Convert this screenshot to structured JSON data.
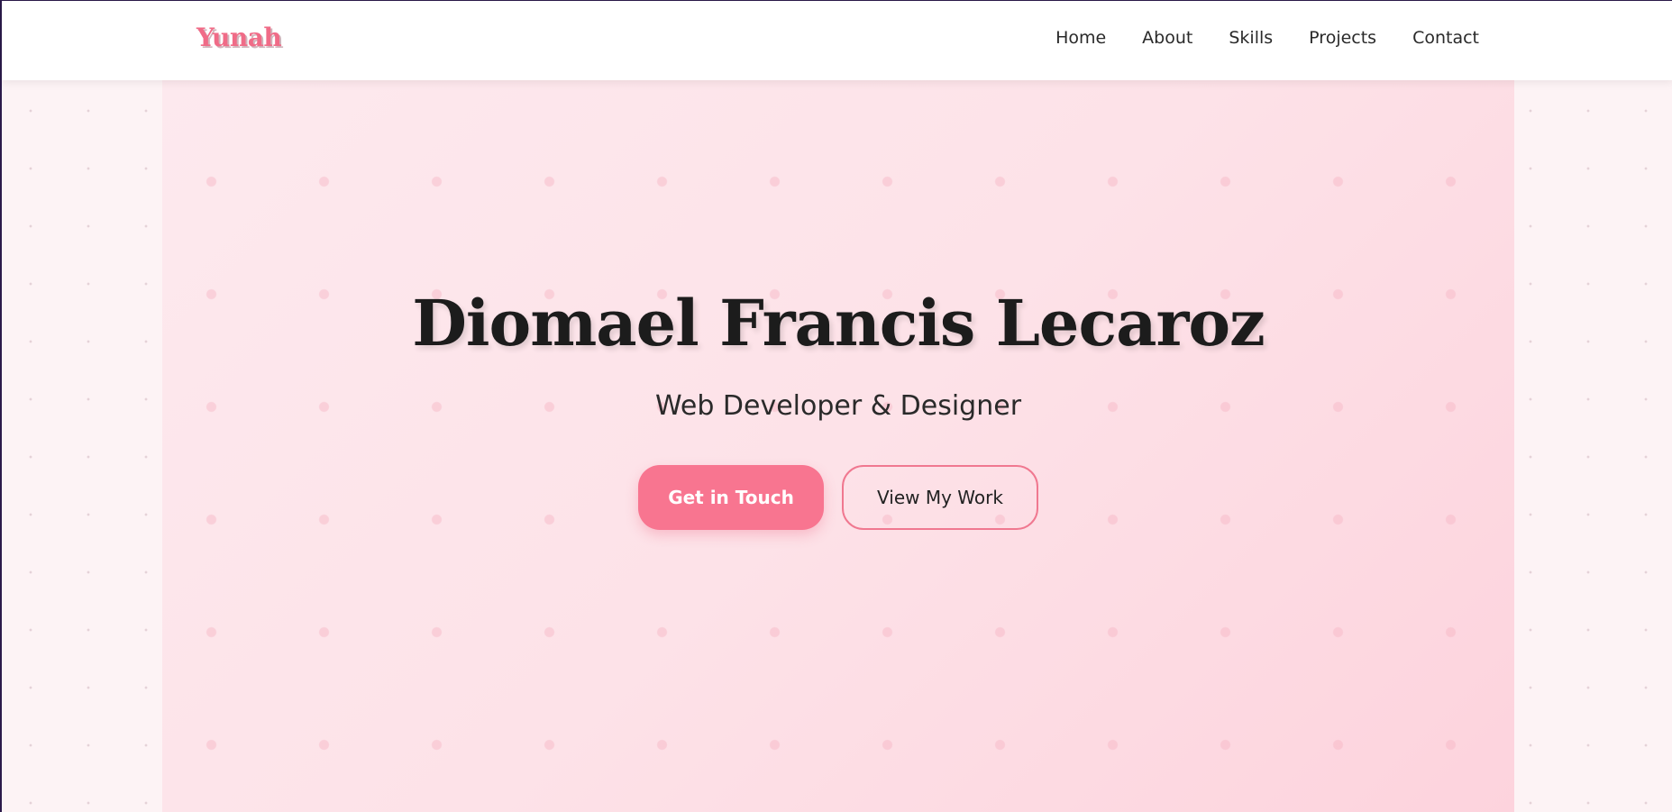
{
  "brand": {
    "logo_text": "Yunah",
    "accent_color": "#f87590"
  },
  "nav": {
    "links": [
      {
        "label": "Home"
      },
      {
        "label": "About"
      },
      {
        "label": "Skills"
      },
      {
        "label": "Projects"
      },
      {
        "label": "Contact"
      }
    ]
  },
  "hero": {
    "title": "Diomael Francis Lecaroz",
    "subtitle": "Web Developer & Designer",
    "primary_button": "Get in Touch",
    "secondary_button": "View My Work"
  }
}
